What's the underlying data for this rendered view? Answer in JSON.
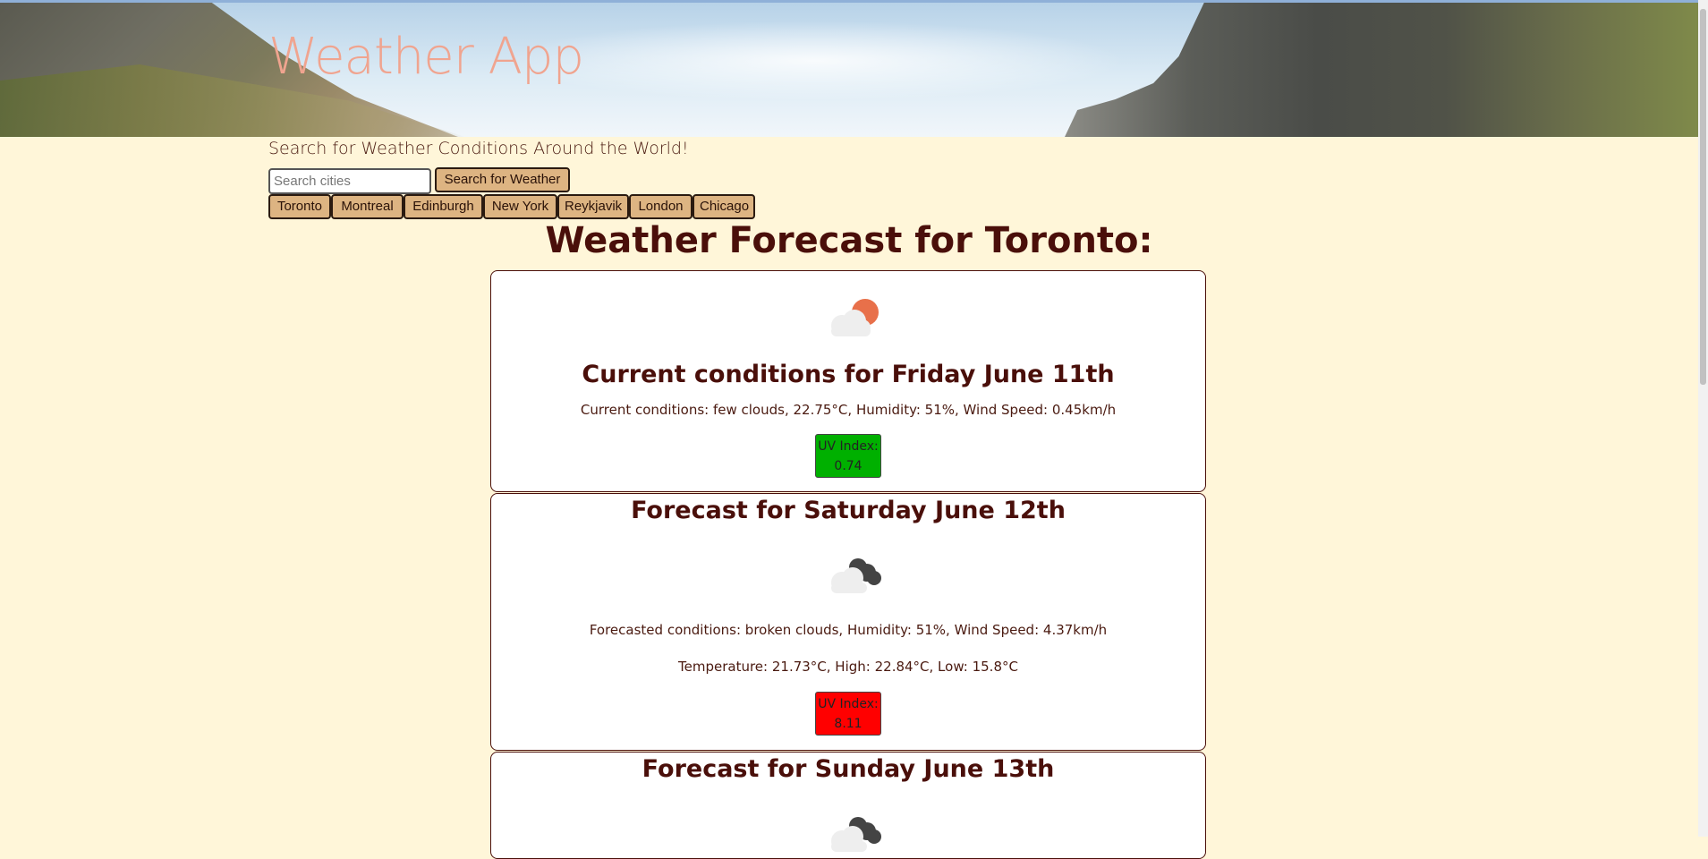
{
  "header": {
    "title": "Weather App"
  },
  "search": {
    "subtitle": "Search for Weather Conditions Around the World!",
    "placeholder": "Search cities",
    "button_label": "Search for Weather"
  },
  "cities": [
    "Toronto",
    "Montreal",
    "Edinburgh",
    "New York",
    "Reykjavik",
    "London",
    "Chicago"
  ],
  "forecast_heading": "Weather Forecast for Toronto:",
  "current": {
    "icon": "few-clouds-icon",
    "title": "Current conditions for Friday June 11th",
    "conditions": "Current conditions: few clouds, 22.75°C, Humidity: 51%, Wind Speed: 0.45km/h",
    "uv_label": "UV Index:",
    "uv_value": "0.74",
    "uv_color": "#00b000"
  },
  "forecasts": [
    {
      "title": "Forecast for Saturday June 12th",
      "icon": "broken-clouds-icon",
      "conditions": "Forecasted conditions: broken clouds, Humidity: 51%, Wind Speed: 4.37km/h",
      "temperature": "Temperature: 21.73°C, High: 22.84°C, Low: 15.8°C",
      "uv_label": "UV Index:",
      "uv_value": "8.11",
      "uv_color": "#ff0000"
    },
    {
      "title": "Forecast for Sunday June 13th",
      "icon": "broken-clouds-icon"
    }
  ],
  "colors": {
    "page_bg": "#fff6d9",
    "accent": "#4a0f0a",
    "button_bg": "#ddb482",
    "title_color": "#f0a48f"
  }
}
